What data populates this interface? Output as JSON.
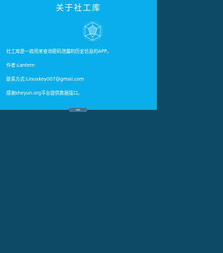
{
  "app_bar": {
    "title": "关于社工库"
  },
  "logo": {
    "icon": "polyhedron-logo-icon"
  },
  "info": {
    "description": "社工库是一款用来查询密码泄露的历史信息的APP。",
    "author": "作者:Lantern",
    "contact": "联系方式:Linuxkey007@gmail.com",
    "thanks": "感谢sheyun.org平台提供数据接口。"
  },
  "colors": {
    "panel": "#0aaeea",
    "background": "#0d4a66",
    "text": "#ffffff"
  }
}
